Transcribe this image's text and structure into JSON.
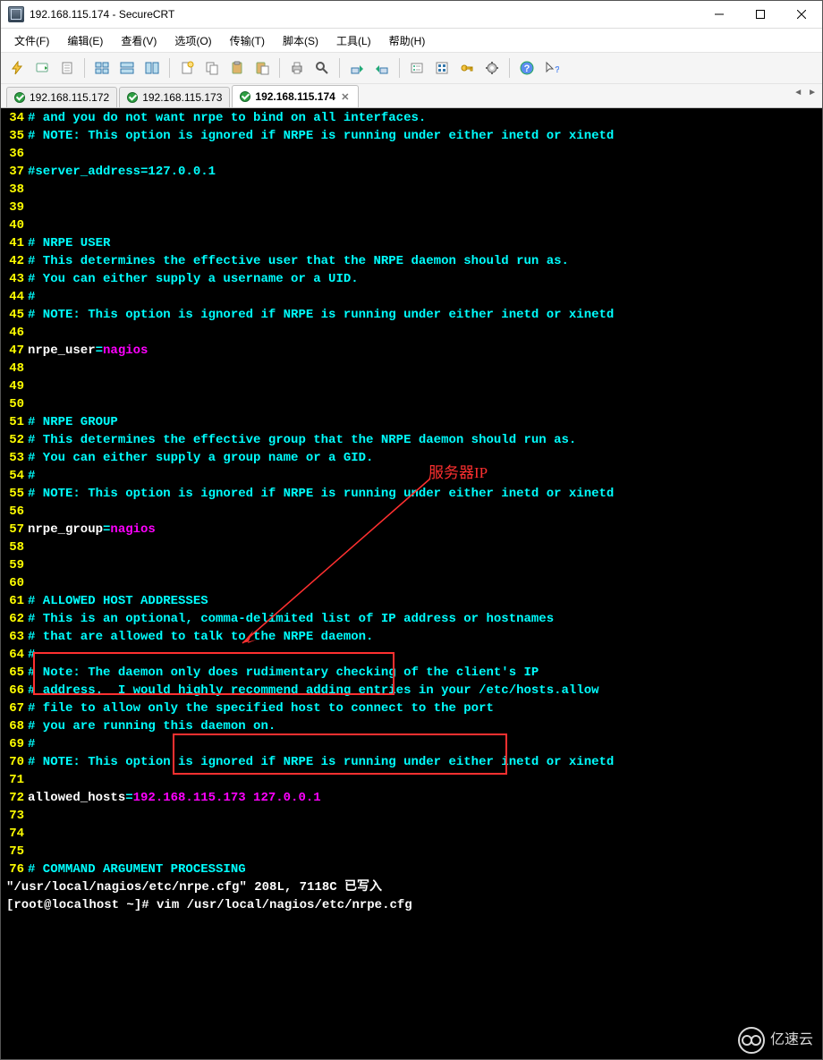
{
  "window": {
    "title": "192.168.115.174 - SecureCRT"
  },
  "menu": {
    "file": "文件(F)",
    "edit": "编辑(E)",
    "view": "查看(V)",
    "option": "选项(O)",
    "transfer": "传输(T)",
    "script": "脚本(S)",
    "tools": "工具(L)",
    "help": "帮助(H)"
  },
  "tabs": [
    {
      "label": "192.168.115.172",
      "active": false
    },
    {
      "label": "192.168.115.173",
      "active": false
    },
    {
      "label": "192.168.115.174",
      "active": true
    }
  ],
  "annotation": {
    "server_ip": "服务器IP"
  },
  "watermark": {
    "text": "亿速云"
  },
  "icons": {
    "lightning": "lightning-icon",
    "quick": "quick-connect-icon",
    "script": "script-icon",
    "grid": "grid-icon",
    "grid2": "grid2-icon",
    "grid3": "grid3-icon",
    "new": "new-session-icon",
    "copy": "copy-icon",
    "paste": "paste-icon",
    "paste2": "paste-special-icon",
    "print": "print-icon",
    "find": "find-icon",
    "send": "send-icon",
    "recv": "receive-icon",
    "props": "properties-icon",
    "opts": "options-icon",
    "key": "key-icon",
    "gear": "settings-icon",
    "help": "help-icon",
    "help2": "context-help-icon"
  },
  "lines": [
    {
      "n": "34",
      "t": [
        {
          "c": "c-cyan",
          "v": "# and you do not want nrpe to bind on all interfaces."
        }
      ]
    },
    {
      "n": "35",
      "t": [
        {
          "c": "c-cyan",
          "v": "# NOTE: This option is ignored if NRPE is running under either inetd or xinetd"
        }
      ]
    },
    {
      "n": "36",
      "t": []
    },
    {
      "n": "37",
      "t": [
        {
          "c": "c-cyan",
          "v": "#server_address=127.0.0.1"
        }
      ]
    },
    {
      "n": "38",
      "t": []
    },
    {
      "n": "39",
      "t": []
    },
    {
      "n": "40",
      "t": []
    },
    {
      "n": "41",
      "t": [
        {
          "c": "c-cyan",
          "v": "# NRPE USER"
        }
      ]
    },
    {
      "n": "42",
      "t": [
        {
          "c": "c-cyan",
          "v": "# This determines the effective user that the NRPE daemon should run as."
        }
      ]
    },
    {
      "n": "43",
      "t": [
        {
          "c": "c-cyan",
          "v": "# You can either supply a username or a UID."
        }
      ]
    },
    {
      "n": "44",
      "t": [
        {
          "c": "c-cyan",
          "v": "#"
        }
      ]
    },
    {
      "n": "45",
      "t": [
        {
          "c": "c-cyan",
          "v": "# NOTE: This option is ignored if NRPE is running under either inetd or xinetd"
        }
      ]
    },
    {
      "n": "46",
      "t": []
    },
    {
      "n": "47",
      "t": [
        {
          "c": "c-white",
          "v": "nrpe_user"
        },
        {
          "c": "c-cyan",
          "v": "="
        },
        {
          "c": "c-mag",
          "v": "nagios"
        }
      ]
    },
    {
      "n": "48",
      "t": []
    },
    {
      "n": "49",
      "t": []
    },
    {
      "n": "50",
      "t": []
    },
    {
      "n": "51",
      "t": [
        {
          "c": "c-cyan",
          "v": "# NRPE GROUP"
        }
      ]
    },
    {
      "n": "52",
      "t": [
        {
          "c": "c-cyan",
          "v": "# This determines the effective group that the NRPE daemon should run as."
        }
      ]
    },
    {
      "n": "53",
      "t": [
        {
          "c": "c-cyan",
          "v": "# You can either supply a group name or a GID."
        }
      ]
    },
    {
      "n": "54",
      "t": [
        {
          "c": "c-cyan",
          "v": "#"
        }
      ]
    },
    {
      "n": "55",
      "t": [
        {
          "c": "c-cyan",
          "v": "# NOTE: This option is ignored if NRPE is running under either inetd or xinetd"
        }
      ]
    },
    {
      "n": "56",
      "t": []
    },
    {
      "n": "57",
      "t": [
        {
          "c": "c-white",
          "v": "nrpe_group"
        },
        {
          "c": "c-cyan",
          "v": "="
        },
        {
          "c": "c-mag",
          "v": "nagios"
        }
      ]
    },
    {
      "n": "58",
      "t": []
    },
    {
      "n": "59",
      "t": []
    },
    {
      "n": "60",
      "t": []
    },
    {
      "n": "61",
      "t": [
        {
          "c": "c-cyan",
          "v": "# ALLOWED HOST ADDRESSES"
        }
      ]
    },
    {
      "n": "62",
      "t": [
        {
          "c": "c-cyan",
          "v": "# This is an optional, comma-delimited list of IP address or hostnames"
        }
      ]
    },
    {
      "n": "63",
      "t": [
        {
          "c": "c-cyan",
          "v": "# that are allowed to talk to the NRPE daemon."
        }
      ]
    },
    {
      "n": "64",
      "t": [
        {
          "c": "c-cyan",
          "v": "#"
        }
      ]
    },
    {
      "n": "65",
      "t": [
        {
          "c": "c-cyan",
          "v": "# Note: The daemon only does rudimentary checking of the client's IP"
        }
      ]
    },
    {
      "n": "66",
      "t": [
        {
          "c": "c-cyan",
          "v": "# address.  I would highly recommend adding entries in your /etc/hosts.allow"
        }
      ]
    },
    {
      "n": "67",
      "t": [
        {
          "c": "c-cyan",
          "v": "# file to allow only the specified host to connect to the port"
        }
      ]
    },
    {
      "n": "68",
      "t": [
        {
          "c": "c-cyan",
          "v": "# you are running this daemon on."
        }
      ]
    },
    {
      "n": "69",
      "t": [
        {
          "c": "c-cyan",
          "v": "#"
        }
      ]
    },
    {
      "n": "70",
      "t": [
        {
          "c": "c-cyan",
          "v": "# NOTE: This option is ignored if NRPE is running under either inetd or xinetd"
        }
      ]
    },
    {
      "n": "71",
      "t": []
    },
    {
      "n": "72",
      "t": [
        {
          "c": "c-white",
          "v": "allowed_hosts"
        },
        {
          "c": "c-cyan",
          "v": "="
        },
        {
          "c": "c-mag",
          "v": "192.168.115.173 127.0.0.1"
        }
      ]
    },
    {
      "n": "73",
      "t": []
    },
    {
      "n": "74",
      "t": []
    },
    {
      "n": "75",
      "t": []
    },
    {
      "n": "76",
      "t": [
        {
          "c": "c-cyan",
          "v": "# COMMAND ARGUMENT PROCESSING"
        }
      ]
    }
  ],
  "status": {
    "line1": "\"/usr/local/nagios/etc/nrpe.cfg\" 208L, 7118C 已写入",
    "prompt": "[root@localhost ~]# ",
    "cmd": "vim /usr/local/nagios/etc/nrpe.cfg"
  }
}
